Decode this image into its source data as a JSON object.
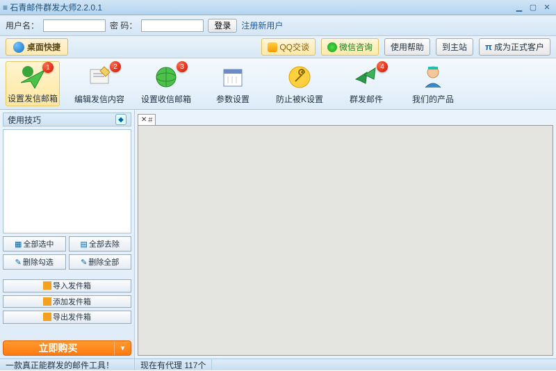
{
  "window": {
    "title": "≡ 石青邮件群发大师2.2.0.1"
  },
  "auth": {
    "user_label": "用户名：",
    "pass_label": "密  码：",
    "login": "登录",
    "register": "注册新用户"
  },
  "toolbar": {
    "desktop_shortcut": "桌面快捷",
    "qq": "QQ交谈",
    "wechat": "微信咨询",
    "help": "使用帮助",
    "mainsite": "到主站",
    "upgrade": "成为正式客户",
    "pi": "π"
  },
  "ribbon": [
    {
      "label": "设置发信邮箱",
      "badge": "1"
    },
    {
      "label": "编辑发信内容",
      "badge": "2"
    },
    {
      "label": "设置收信邮箱",
      "badge": "3"
    },
    {
      "label": "参数设置",
      "badge": null
    },
    {
      "label": "防止被K设置",
      "badge": null
    },
    {
      "label": "群发邮件",
      "badge": "4"
    },
    {
      "label": "我们的产品",
      "badge": null
    }
  ],
  "sidebar": {
    "tips_header": "使用技巧",
    "select_all": "全部选中",
    "remove_all": "全部去除",
    "delete_checked": "删除勾选",
    "delete_all": "删除全部",
    "import_box": "导入发件箱",
    "add_box": "添加发件箱",
    "export_box": "导出发件箱",
    "buy_now": "立即购买"
  },
  "content": {
    "tab_hash": "#"
  },
  "status": {
    "left": "一款真正能群发的邮件工具！",
    "right": "现在有代理 117个"
  }
}
